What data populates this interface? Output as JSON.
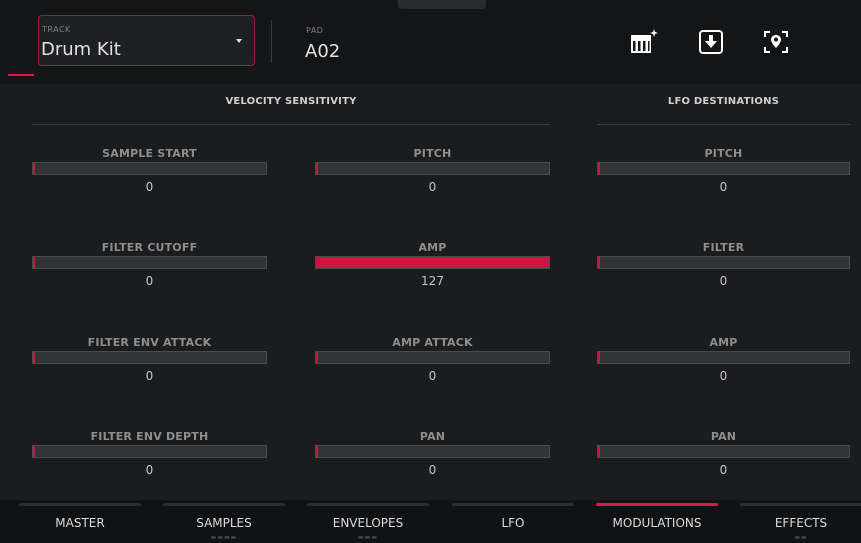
{
  "header": {
    "track": {
      "label": "TRACK",
      "value": "Drum Kit"
    },
    "pad": {
      "label": "PAD",
      "value": "A02"
    },
    "icons": [
      "piano-sparkle-icon",
      "download-icon",
      "locate-icon"
    ]
  },
  "sections": {
    "velocity": "VELOCITY SENSITIVITY",
    "lfo": "LFO  DESTINATIONS"
  },
  "params": {
    "velocity_left": [
      {
        "label": "SAMPLE START",
        "value": "0",
        "level": 0
      },
      {
        "label": "FILTER CUTOFF",
        "value": "0",
        "level": 0
      },
      {
        "label": "FILTER ENV ATTACK",
        "value": "0",
        "level": 0
      },
      {
        "label": "FILTER ENV DEPTH",
        "value": "0",
        "level": 0
      }
    ],
    "velocity_right": [
      {
        "label": "PITCH",
        "value": "0",
        "level": 0
      },
      {
        "label": "AMP",
        "value": "127",
        "level": 1.0
      },
      {
        "label": "AMP ATTACK",
        "value": "0",
        "level": 0
      },
      {
        "label": "PAN",
        "value": "0",
        "level": 0
      }
    ],
    "lfo": [
      {
        "label": "PITCH",
        "value": "0",
        "level": 0
      },
      {
        "label": "FILTER",
        "value": "0",
        "level": 0
      },
      {
        "label": "AMP",
        "value": "0",
        "level": 0
      },
      {
        "label": "PAN",
        "value": "0",
        "level": 0
      }
    ]
  },
  "tabs": [
    {
      "label": "MASTER",
      "active": false,
      "dots": ""
    },
    {
      "label": "SAMPLES",
      "active": false,
      "dots": "▬▬▬▬"
    },
    {
      "label": "ENVELOPES",
      "active": false,
      "dots": "▬▬▬"
    },
    {
      "label": "LFO",
      "active": false,
      "dots": ""
    },
    {
      "label": "MODULATIONS",
      "active": true,
      "dots": ""
    },
    {
      "label": "EFFECTS",
      "active": false,
      "dots": "▬▬"
    }
  ],
  "colors": {
    "accent": "#d81b4b",
    "fill": "#c8163f",
    "background": "#1b1c1e"
  }
}
